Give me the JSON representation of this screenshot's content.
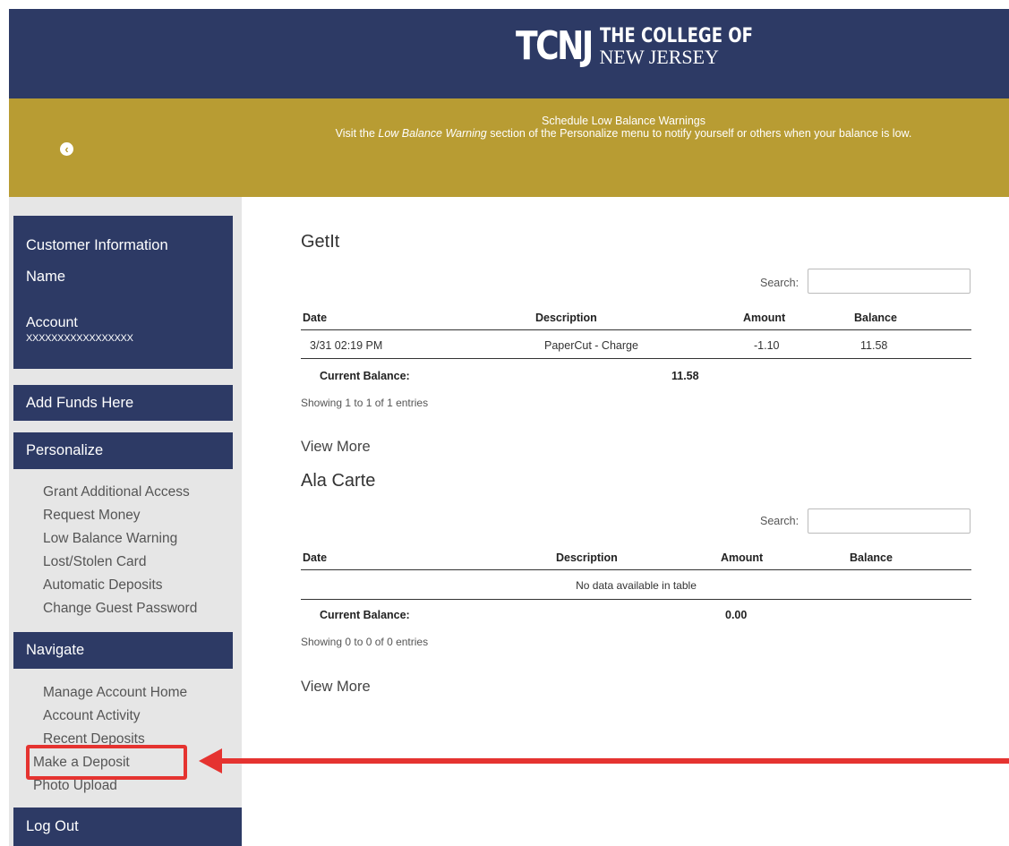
{
  "header": {
    "logo_mark": "TCNJ",
    "logo_line1": "THE COLLEGE OF",
    "logo_line2": "NEW JERSEY",
    "bg_color": "#2d3a65"
  },
  "banner": {
    "back_icon": "chevron-left-circle-icon",
    "title": "Schedule Low Balance Warnings",
    "text_before": "Visit the ",
    "text_emphasis": "Low Balance Warning",
    "text_after": " section of the Personalize menu to notify yourself or others when your balance is low.",
    "bg_color": "#b89c33"
  },
  "sidebar": {
    "customer_info_label": "Customer Information",
    "name_label": "Name",
    "account_label": "Account",
    "account_value": "XXXXXXXXXXXXXXXXX",
    "add_funds_label": "Add Funds Here",
    "personalize_label": "Personalize",
    "personalize_items": [
      "Grant Additional Access",
      "Request Money",
      "Low Balance Warning",
      "Lost/Stolen Card",
      "Automatic Deposits",
      "Change Guest Password"
    ],
    "navigate_label": "Navigate",
    "navigate_items": [
      "Manage Account Home",
      "Account Activity",
      "Recent Deposits",
      "Make a Deposit",
      "Photo Upload"
    ],
    "logout_label": "Log Out"
  },
  "annotation": {
    "highlight_color": "#e53330"
  },
  "getit": {
    "title": "GetIt",
    "search_label": "Search:",
    "search_value": "",
    "columns": [
      "Date",
      "Description",
      "Amount",
      "Balance"
    ],
    "rows": [
      {
        "date": "3/31 02:19 PM",
        "description": "PaperCut - Charge",
        "amount": "-1.10",
        "balance": "11.58"
      }
    ],
    "current_balance_label": "Current Balance:",
    "current_balance_value": "11.58",
    "showing": "Showing 1 to 1 of 1 entries",
    "view_more": "View More"
  },
  "alacarte": {
    "title": "Ala Carte",
    "search_label": "Search:",
    "search_value": "",
    "columns": [
      "Date",
      "Description",
      "Amount",
      "Balance"
    ],
    "empty_text": "No data available in table",
    "current_balance_label": "Current Balance:",
    "current_balance_value": "0.00",
    "showing": "Showing 0 to 0 of 0 entries",
    "view_more": "View More"
  }
}
